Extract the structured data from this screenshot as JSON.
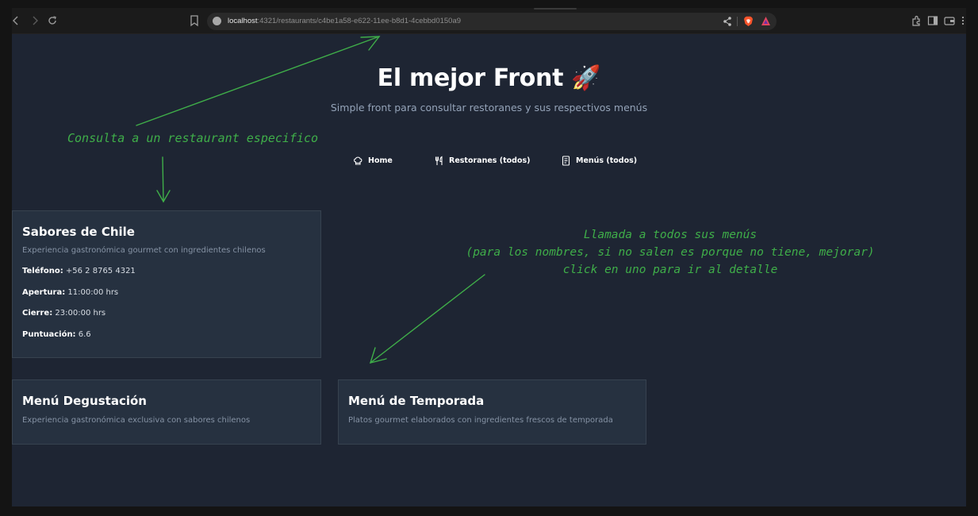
{
  "browser": {
    "url_host": "localhost",
    "url_path": ":4321/restaurants/c4be1a58-e622-11ee-b8d1-4cebbd0150a9"
  },
  "header": {
    "title": "El mejor Front 🚀",
    "subtitle": "Simple front para consultar restoranes y sus respectivos menús"
  },
  "nav": {
    "home": "Home",
    "restaurants": "Restoranes (todos)",
    "menus": "Menús (todos)"
  },
  "restaurant": {
    "name": "Sabores de Chile",
    "description": "Experiencia gastronómica gourmet con ingredientes chilenos",
    "phone_label": "Teléfono:",
    "phone": "+56 2 8765 4321",
    "open_label": "Apertura:",
    "open": "11:00:00 hrs",
    "close_label": "Cierre:",
    "close": "23:00:00 hrs",
    "score_label": "Puntuación:",
    "score": "6.6"
  },
  "menus": [
    {
      "name": "Menú Degustación",
      "description": "Experiencia gastronómica exclusiva con sabores chilenos"
    },
    {
      "name": "Menú de Temporada",
      "description": "Platos gourmet elaborados con ingredientes frescos de temporada"
    }
  ],
  "annotations": {
    "left": "Consulta a un restaurant especifico",
    "right_line1": "Llamada a todos sus menús",
    "right_line2": "(para los nombres, si no salen es porque no tiene, mejorar)",
    "right_line3": "click en uno para ir al detalle"
  },
  "colors": {
    "page_bg": "#1e2533",
    "card_bg": "#263140",
    "annotation": "#3fae49"
  }
}
